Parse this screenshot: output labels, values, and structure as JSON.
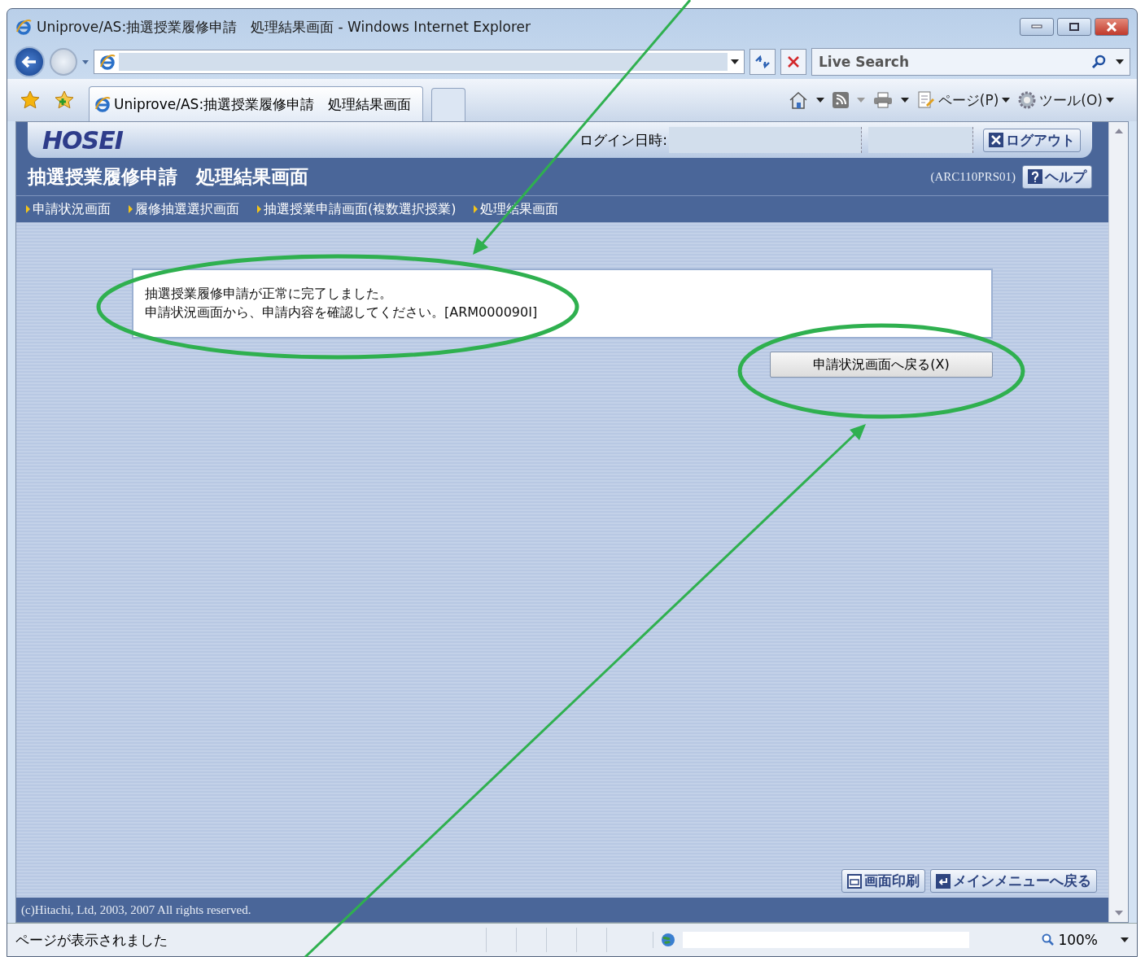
{
  "window": {
    "title": "Uniprove/AS:抽選授業履修申請　処理結果画面 - Windows Internet Explorer"
  },
  "search": {
    "placeholder": "Live Search"
  },
  "tab": {
    "title": "Uniprove/AS:抽選授業履修申請　処理結果画面"
  },
  "command_bar": {
    "page_menu": "ページ(P)",
    "tools_menu": "ツール(O)"
  },
  "page": {
    "logo": "HOSEI",
    "login_label": "ログイン日時:",
    "logout": "ログアウト",
    "title": "抽選授業履修申請　処理結果画面",
    "screen_id": "(ARC110PRS01)",
    "help": "ヘルプ",
    "breadcrumbs": [
      "申請状況画面",
      "履修抽選選択画面",
      "抽選授業申請画面(複数選択授業)",
      "処理結果画面"
    ],
    "message": [
      "抽選授業履修申請が正常に完了しました。",
      "申請状況画面から、申請内容を確認してください。[ARM000090I]"
    ],
    "back_button": "申請状況画面へ戻る(X)",
    "print_button": "画面印刷",
    "main_menu_button": "メインメニューへ戻る",
    "copyright": "(c)Hitachi, Ltd, 2003, 2007 All rights reserved."
  },
  "status_bar": {
    "text": "ページが表示されました",
    "zoom": "100%"
  }
}
